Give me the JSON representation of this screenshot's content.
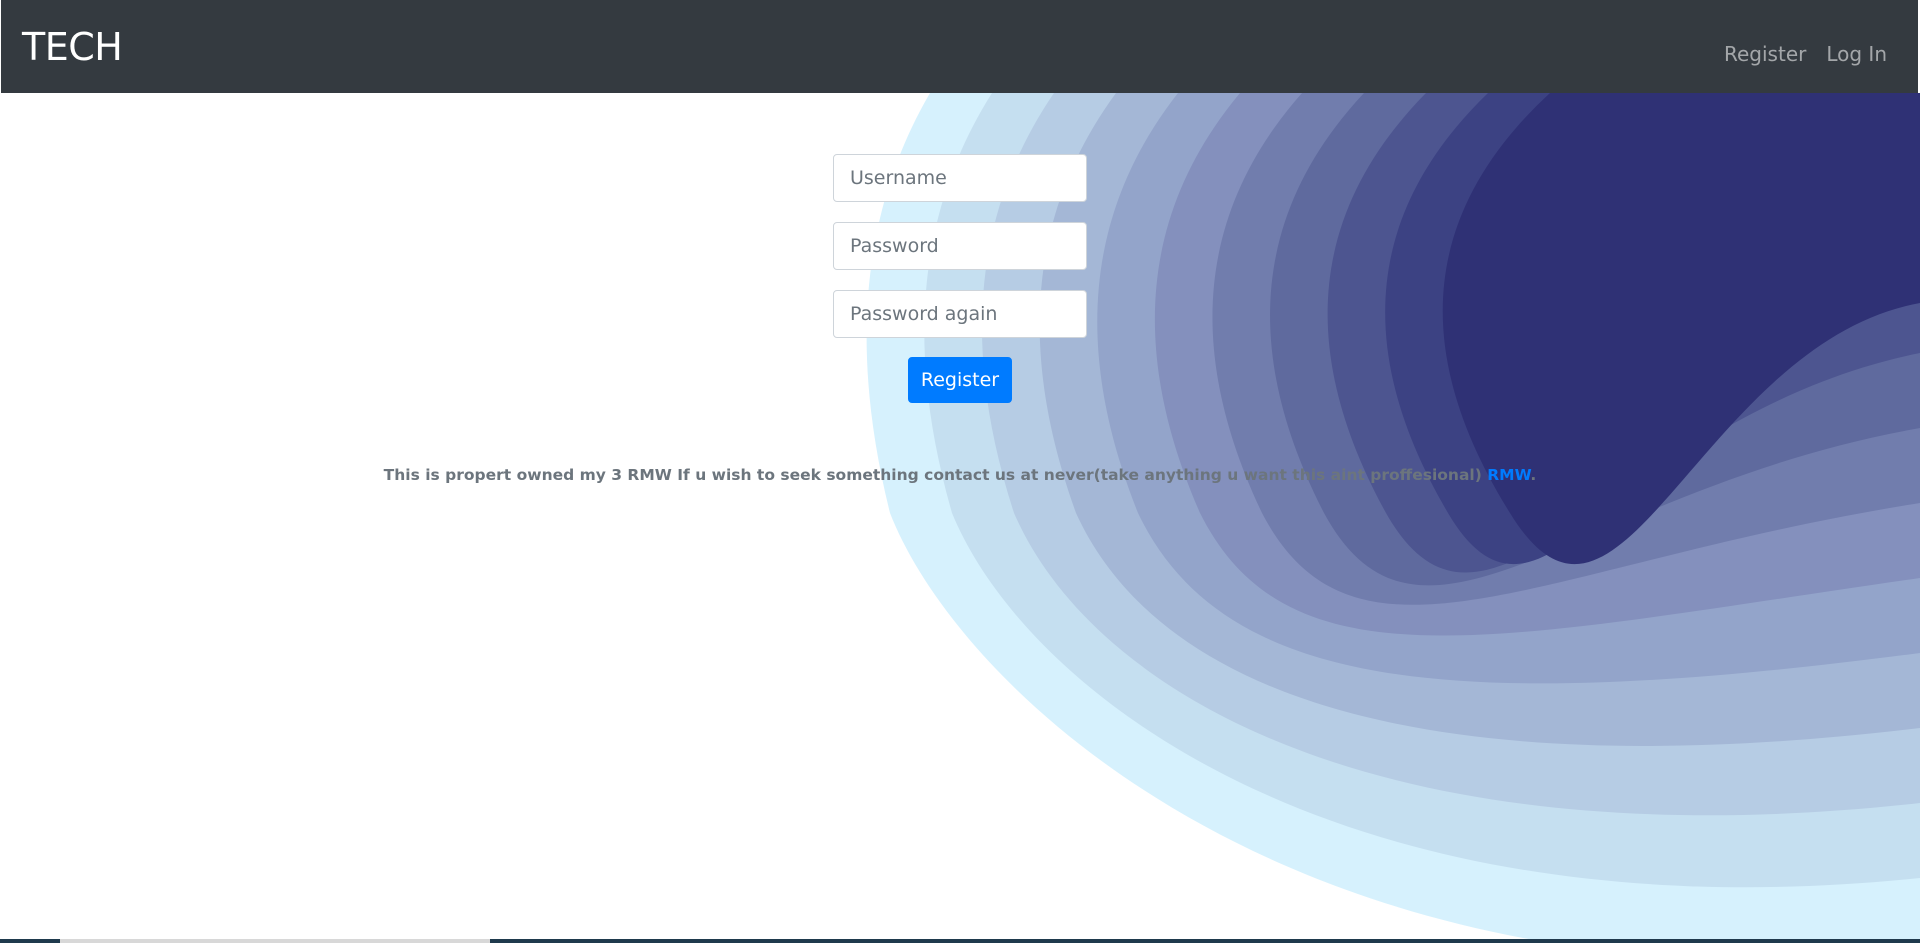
{
  "navbar": {
    "brand": "TECH",
    "links": [
      "Register",
      "Log In"
    ]
  },
  "form": {
    "username_placeholder": "Username",
    "password_placeholder": "Password",
    "password_again_placeholder": "Password again",
    "submit_label": "Register"
  },
  "footer": {
    "text": "This is propert owned my 3 RMW If u wish to seek something contact us at never(take anything u want this aint proffesional) ",
    "link_text": "RMW",
    "suffix": "."
  },
  "colors": {
    "navbar_bg": "#343a40",
    "primary": "#007bff",
    "wave_colors": [
      "#d6f1fd",
      "#c5dff0",
      "#b6cce4",
      "#a4b7d6",
      "#93a4ca",
      "#8490bd",
      "#717dad",
      "#5f6a9e",
      "#4d5590",
      "#3c4283",
      "#2f3175"
    ]
  }
}
